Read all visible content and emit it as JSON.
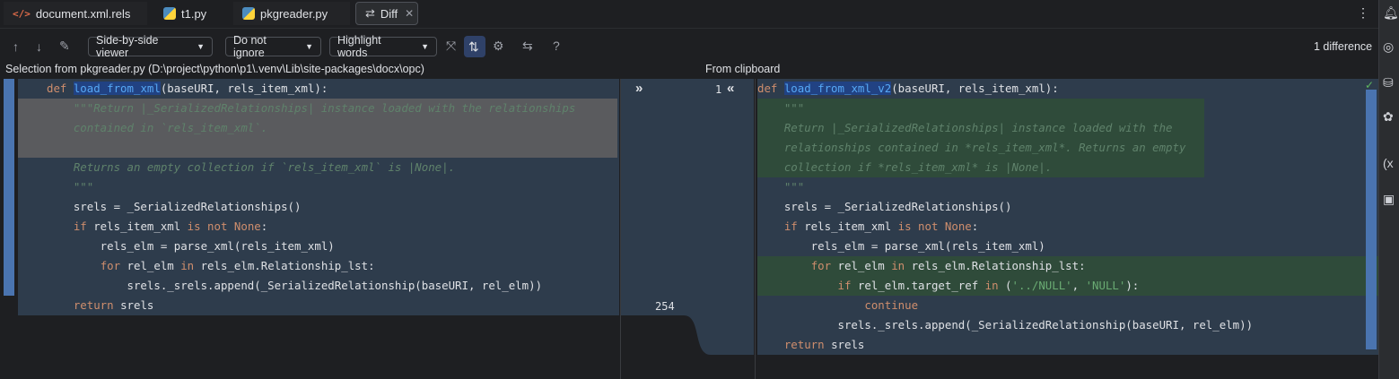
{
  "tabs": [
    {
      "label": "document.xml.rels"
    },
    {
      "label": "t1.py"
    },
    {
      "label": "pkgreader.py"
    },
    {
      "label": "Diff"
    }
  ],
  "toolbar": {
    "viewer": "Side-by-side viewer",
    "ignore": "Do not ignore",
    "highlight": "Highlight words",
    "diff_count": "1 difference"
  },
  "headers": {
    "left": "Selection from pkgreader.py (D:\\project\\python\\p1\\.venv\\Lib\\site-packages\\docx\\opc)",
    "right": "From clipboard"
  },
  "gutter": {
    "left_start": "1",
    "left_end": "254"
  },
  "left_code": [
    "def load_from_xml(baseURI, rels_item_xml):",
    "    \"\"\"Return |_SerializedRelationships| instance loaded with the relationships",
    "    contained in `rels_item_xml`.",
    "",
    "    Returns an empty collection if `rels_item_xml` is |None|.",
    "    \"\"\"",
    "    srels = _SerializedRelationships()",
    "    if rels_item_xml is not None:",
    "        rels_elm = parse_xml(rels_item_xml)",
    "        for rel_elm in rels_elm.Relationship_lst:",
    "            srels._srels.append(_SerializedRelationship(baseURI, rel_elm))",
    "    return srels"
  ],
  "right_code": [
    "def load_from_xml_v2(baseURI, rels_item_xml):",
    "    \"\"\"",
    "    Return |_SerializedRelationships| instance loaded with the",
    "    relationships contained in *rels_item_xml*. Returns an empty",
    "    collection if *rels_item_xml* is |None|.",
    "    \"\"\"",
    "    srels = _SerializedRelationships()",
    "    if rels_item_xml is not None:",
    "        rels_elm = parse_xml(rels_item_xml)",
    "        for rel_elm in rels_elm.Relationship_lst:",
    "            if rel_elm.target_ref in ('../NULL', 'NULL'):",
    "                continue",
    "            srels._srels.append(_SerializedRelationship(baseURI, rel_elm))",
    "    return srels"
  ]
}
